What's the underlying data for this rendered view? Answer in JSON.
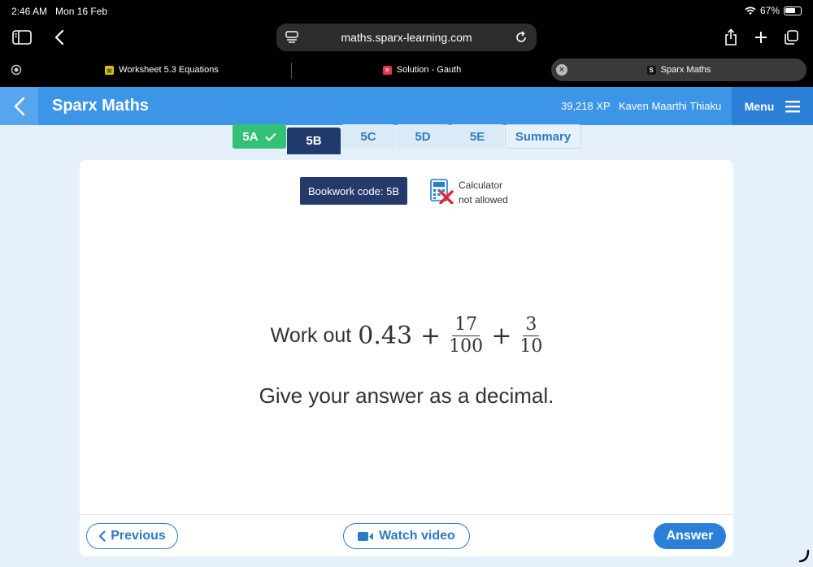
{
  "status": {
    "time": "2:46 AM",
    "date": "Mon 16 Feb",
    "battery": "67%",
    "battery_level": 0.67
  },
  "browser": {
    "url": "maths.sparx-learning.com",
    "tabs": [
      {
        "label": "Worksheet 5.3 Equations",
        "icon": "classroom-icon",
        "active": false
      },
      {
        "label": "Solution - Gauth",
        "icon": "gauth-icon",
        "active": false
      },
      {
        "label": "Sparx Maths",
        "icon": "sparx-icon",
        "icon_text": "S",
        "active": true
      }
    ]
  },
  "header": {
    "brand": "Sparx Maths",
    "xp": "39,218 XP",
    "user": "Kaven Maarthi Thiaku",
    "menu_label": "Menu",
    "color": "#3d95e8"
  },
  "subtabs": [
    {
      "label": "5A",
      "state": "done"
    },
    {
      "label": "5B",
      "state": "current"
    },
    {
      "label": "5C",
      "state": "todo"
    },
    {
      "label": "5D",
      "state": "todo"
    },
    {
      "label": "5E",
      "state": "todo"
    },
    {
      "label": "Summary",
      "state": "summary"
    }
  ],
  "question": {
    "bookwork": "Bookwork code: 5B",
    "calculator_line1": "Calculator",
    "calculator_line2": "not allowed",
    "prompt": "Work out",
    "decimal": "0.43",
    "plus": "+",
    "frac1_num": "17",
    "frac1_den": "100",
    "frac2_num": "3",
    "frac2_den": "10",
    "instruction": "Give your answer as a decimal."
  },
  "footer": {
    "previous": "Previous",
    "watch": "Watch video",
    "answer": "Answer"
  }
}
